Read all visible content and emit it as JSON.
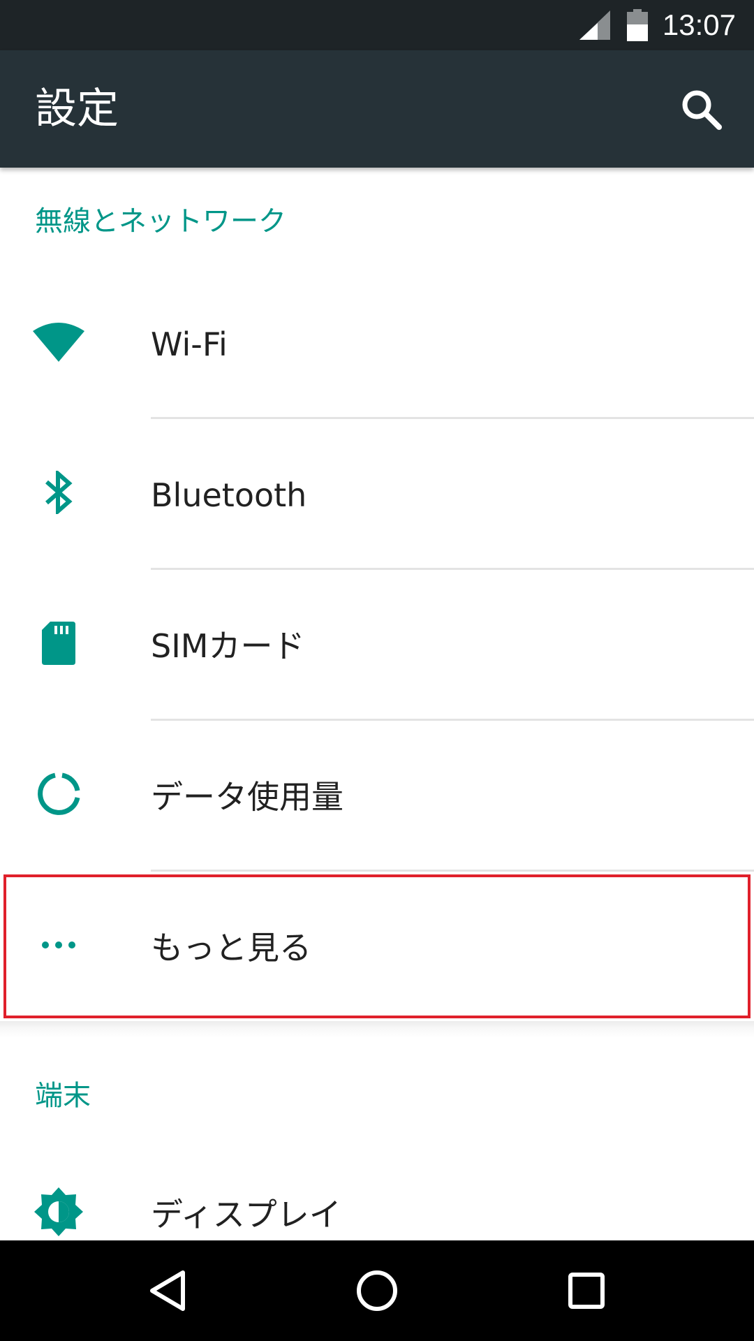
{
  "status_bar": {
    "time": "13:07",
    "icons": [
      "cell-signal-icon",
      "battery-icon"
    ]
  },
  "app_bar": {
    "title": "設定",
    "search_icon": "search-icon"
  },
  "sections": [
    {
      "header": "無線とネットワーク",
      "items": [
        {
          "label": "Wi-Fi",
          "icon": "wifi-icon"
        },
        {
          "label": "Bluetooth",
          "icon": "bluetooth-icon"
        },
        {
          "label": "SIMカード",
          "icon": "sim-card-icon"
        },
        {
          "label": "データ使用量",
          "icon": "data-usage-icon"
        },
        {
          "label": "もっと見る",
          "icon": "more-horiz-icon",
          "highlighted": true
        }
      ]
    },
    {
      "header": "端末",
      "items": [
        {
          "label": "ディスプレイ",
          "icon": "brightness-icon"
        }
      ]
    }
  ],
  "nav_bar": {
    "icons": [
      "back-icon",
      "home-icon",
      "recents-icon"
    ]
  },
  "colors": {
    "status_bar": "#1e2427",
    "app_bar": "#263238",
    "accent": "#009688",
    "highlight_border": "#e0202b",
    "nav_bar": "#000000"
  }
}
